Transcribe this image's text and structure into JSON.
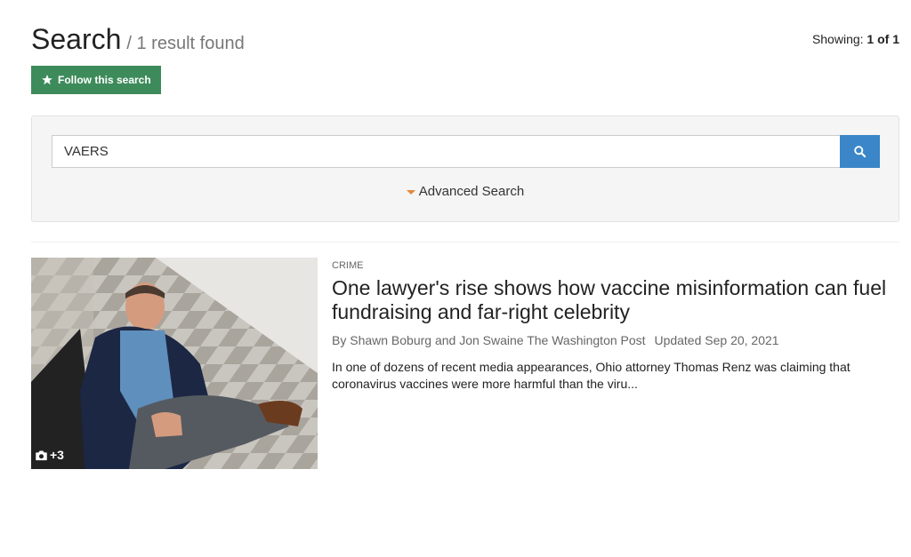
{
  "header": {
    "title": "Search",
    "subtitle": "/ 1 result found",
    "showing_label": "Showing:",
    "showing_value": "1 of 1"
  },
  "follow_button": {
    "label": "Follow this search",
    "icon": "star-icon",
    "color": "#3d8b5b"
  },
  "search": {
    "query": "VAERS",
    "button_icon": "search-icon",
    "button_color": "#3a86c8",
    "advanced_label": "Advanced Search",
    "advanced_caret_color": "#e08a3c"
  },
  "results": [
    {
      "kicker": "CRIME",
      "headline": "One lawyer's rise shows how vaccine misinformation can fuel fundraising and far-right celebrity",
      "byline": "By Shawn Boburg and Jon Swaine The Washington Post",
      "updated": "Updated Sep 20, 2021",
      "summary": "In one of dozens of recent media appearances, Ohio attorney Thomas Renz was claiming that coronavirus vaccines were more harmful than the viru...",
      "photo_count": "+3",
      "photo_icon": "camera-icon"
    }
  ]
}
